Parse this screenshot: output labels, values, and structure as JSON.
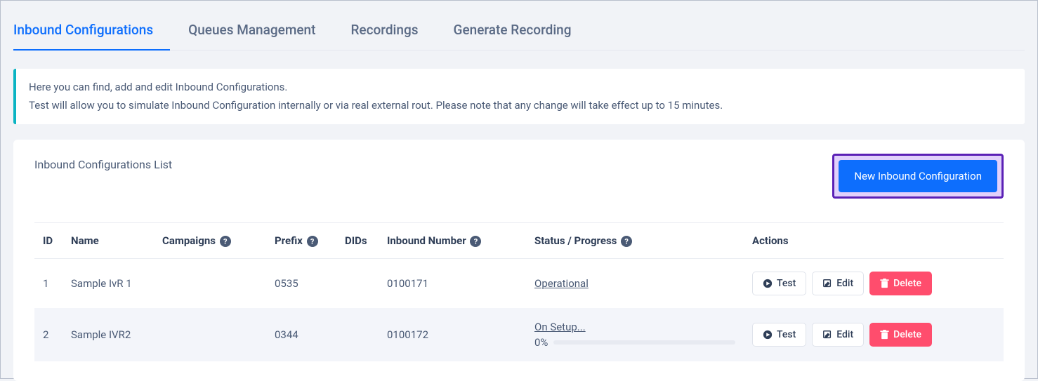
{
  "tabs": [
    {
      "label": "Inbound Configurations",
      "active": true
    },
    {
      "label": "Queues Management",
      "active": false
    },
    {
      "label": "Recordings",
      "active": false
    },
    {
      "label": "Generate Recording",
      "active": false
    }
  ],
  "info": {
    "line1": "Here you can find, add and edit Inbound Configurations.",
    "line2": "Test will allow you to simulate Inbound Configuration internally or via real external rout. Please note that any change will take effect up to 15 minutes."
  },
  "panel": {
    "title": "Inbound Configurations List",
    "new_button": "New Inbound Configuration"
  },
  "table": {
    "headers": {
      "id": "ID",
      "name": "Name",
      "campaigns": "Campaigns",
      "prefix": "Prefix",
      "dids": "DIDs",
      "inbound_number": "Inbound Number",
      "status": "Status / Progress",
      "actions": "Actions"
    },
    "rows": [
      {
        "id": "1",
        "name": "Sample IvR 1",
        "campaigns": "",
        "prefix": "0535",
        "dids": "",
        "inbound_number": "0100171",
        "status_text": "Operational",
        "has_progress": false,
        "progress_pct": ""
      },
      {
        "id": "2",
        "name": "Sample IVR2",
        "campaigns": "",
        "prefix": "0344",
        "dids": "",
        "inbound_number": "0100172",
        "status_text": "On Setup...",
        "has_progress": true,
        "progress_pct": "0%"
      }
    ],
    "actions": {
      "test": "Test",
      "edit": "Edit",
      "delete": "Delete"
    }
  },
  "colors": {
    "accent": "#0d6efd",
    "danger": "#ff4d6d",
    "highlight_border": "#5b21b6",
    "info_border": "#0bb4c3"
  }
}
